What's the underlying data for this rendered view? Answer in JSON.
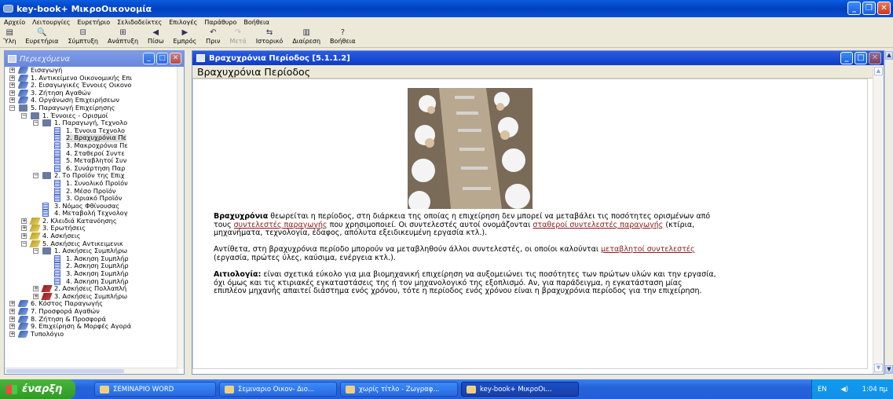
{
  "window": {
    "title": "key-book+   ΜικροΟικονομία"
  },
  "menu": [
    "Αρχείο",
    "Λειτουργίες",
    "Ευρετήριο",
    "Σελιδοδείκτες",
    "Επιλογές",
    "Παράθυρο",
    "Βοήθεια"
  ],
  "toolbar": [
    {
      "label": "Ύλη",
      "icon": "toc-icon",
      "glyph": "▤",
      "enabled": true
    },
    {
      "label": "Ευρετήρια",
      "icon": "search-icon",
      "glyph": "🔍",
      "enabled": true
    },
    {
      "label": "Σύμπτυξη",
      "icon": "collapse-icon",
      "glyph": "⊟",
      "enabled": true
    },
    {
      "label": "Ανάπτυξη",
      "icon": "expand-icon",
      "glyph": "⊞",
      "enabled": true
    },
    {
      "label": "Πίσω",
      "icon": "back-icon",
      "glyph": "◀",
      "enabled": true
    },
    {
      "label": "Εμπρός",
      "icon": "forward-icon",
      "glyph": "▶",
      "enabled": true
    },
    {
      "label": "Πριν",
      "icon": "undo-icon",
      "glyph": "↶",
      "enabled": true
    },
    {
      "label": "Μετά",
      "icon": "redo-icon",
      "glyph": "↷",
      "enabled": false
    },
    {
      "label": "Ιστορικό",
      "icon": "history-icon",
      "glyph": "⇆",
      "enabled": true
    },
    {
      "label": "Διαίρεση",
      "icon": "split-icon",
      "glyph": "▥",
      "enabled": true
    },
    {
      "label": "Βοήθεια",
      "icon": "help-icon",
      "glyph": "?",
      "enabled": true
    }
  ],
  "left_panel": {
    "title": "Περιεχόμενα",
    "tree": [
      {
        "label": "Εισαγωγή",
        "level": 0,
        "icon": "blue",
        "exp": "+"
      },
      {
        "label": "1. Αντικείμενο Οικονομικής Επι",
        "level": 0,
        "icon": "blue",
        "exp": "+"
      },
      {
        "label": "2. Εισαγωγικές Έννοιες Οικονο",
        "level": 0,
        "icon": "blue",
        "exp": "+"
      },
      {
        "label": "3. Ζήτηση Αγαθών",
        "level": 0,
        "icon": "blue",
        "exp": "+"
      },
      {
        "label": "4. Οργάνωση Επιχειρήσεων",
        "level": 0,
        "icon": "blue",
        "exp": "+"
      },
      {
        "label": "5. Παραγωγή Επιχείρησης",
        "level": 0,
        "icon": "book",
        "exp": "−"
      },
      {
        "label": "1. Έννοιες - Ορισμοί",
        "level": 1,
        "icon": "book",
        "exp": "−"
      },
      {
        "label": "1. Παραγωγή, Τεχνολο",
        "level": 2,
        "icon": "book",
        "exp": "−"
      },
      {
        "label": "1. Έννοια Τεχνολο",
        "level": 3,
        "icon": "doc"
      },
      {
        "label": "2. Βραχυχρόνια Πε",
        "level": 3,
        "icon": "doc",
        "selected": true
      },
      {
        "label": "3. Μακροχρόνια Πε",
        "level": 3,
        "icon": "doc"
      },
      {
        "label": "4. Σταθεροί Συντε",
        "level": 3,
        "icon": "doc"
      },
      {
        "label": "5. Μεταβλητοί Συν",
        "level": 3,
        "icon": "doc"
      },
      {
        "label": "6. Συνάρτηση Παρ",
        "level": 3,
        "icon": "doc"
      },
      {
        "label": "2. Το Προϊόν της Επιχ",
        "level": 2,
        "icon": "book",
        "exp": "−"
      },
      {
        "label": "1. Συνολικό Προϊόν",
        "level": 3,
        "icon": "doc"
      },
      {
        "label": "2. Μέσο Προϊόν",
        "level": 3,
        "icon": "doc"
      },
      {
        "label": "3. Οριακό Προϊόν",
        "level": 3,
        "icon": "doc"
      },
      {
        "label": "3. Νόμος Φθίνουσας",
        "level": 2,
        "icon": "doc"
      },
      {
        "label": "4. Μεταβολή Τεχνολογ",
        "level": 2,
        "icon": "doc"
      },
      {
        "label": "2. Κλειδιά Κατανόησης",
        "level": 1,
        "icon": "ylw",
        "exp": "+"
      },
      {
        "label": "3. Ερωτήσεις",
        "level": 1,
        "icon": "ylw",
        "exp": "+"
      },
      {
        "label": "4. Ασκήσεις",
        "level": 1,
        "icon": "ylw",
        "exp": "+"
      },
      {
        "label": "5. Ασκήσεις Αντικειμενικ",
        "level": 1,
        "icon": "ylw",
        "exp": "−"
      },
      {
        "label": "1. Ασκήσεις Συμπλήρω",
        "level": 2,
        "icon": "book",
        "exp": "−"
      },
      {
        "label": "1. Άσκηση Συμπλήρ",
        "level": 3,
        "icon": "doc"
      },
      {
        "label": "2. Άσκηση Συμπλήρ",
        "level": 3,
        "icon": "doc"
      },
      {
        "label": "3. Άσκηση Συμπλήρ",
        "level": 3,
        "icon": "doc"
      },
      {
        "label": "4. Άσκηση Συμπλήρ",
        "level": 3,
        "icon": "doc"
      },
      {
        "label": "2. Ασκήσεις Πολλαπλή",
        "level": 2,
        "icon": "red",
        "exp": "+"
      },
      {
        "label": "3. Ασκήσεις Συμπλήρω",
        "level": 2,
        "icon": "red",
        "exp": "+"
      },
      {
        "label": "6. Κόστος Παραγωγής",
        "level": 0,
        "icon": "blue",
        "exp": "+"
      },
      {
        "label": "7. Προσφορά Αγαθών",
        "level": 0,
        "icon": "blue",
        "exp": "+"
      },
      {
        "label": "8. Ζήτηση & Προσφορά",
        "level": 0,
        "icon": "blue",
        "exp": "+"
      },
      {
        "label": "9. Επιχείρηση & Μορφές Αγορά",
        "level": 0,
        "icon": "blue",
        "exp": "+"
      },
      {
        "label": "Τυπολόγιο",
        "level": 0,
        "icon": "blue",
        "exp": "+"
      }
    ]
  },
  "right_panel": {
    "title": "Βραχυχρόνια Περίοδος   [5.1.1.2]",
    "header": "Βραχυχρόνια Περίοδος",
    "image_alt": "workers-on-assembly-line-photo",
    "p1": {
      "b": "Βραχυχρόνια",
      "t1": " θεωρείται η περίοδος, στη διάρκεια της οποίας η επιχείρηση δεν μπορεί να μεταβάλει τις ποσότητες ορισμένων από τους ",
      "l1": "συντελεστές παραγωγής",
      "t2": " που χρησιμοποιεί. Οι συντελεστές αυτοί ονομάζονται ",
      "l2": "σταθεροί συντελεστές παραγωγής",
      "t3": " (κτίρια, μηχανήματα, τεχνολογία, έδαφος, απόλυτα εξειδικευμένη εργασία κτλ.)."
    },
    "p2": {
      "t1": "Αντίθετα, στη βραχυχρόνια περίοδο μπορούν να μεταβληθούν άλλοι συντελεστές, οι οποίοι καλούνται ",
      "l1": "μεταβλητοί συντελεστές",
      "t2": " (εργασία, πρώτες ύλες, καύσιμα, ενέργεια κτλ.)."
    },
    "p3": {
      "b": "Αιτιολογία:",
      "t1": " είναι σχετικά εύκολο για μια βιομηχανική επιχείρηση να αυξομειώνει τις ποσότητες των πρώτων υλών και την εργασία, όχι όμως και τις κτιριακές εγκαταστάσεις της ή τον μηχανολογικό της εξοπλισμό. Αν, για παράδειγμα, η εγκατάσταση μίας επιπλέον μηχανής απαιτεί διάστημα ενός χρόνου, τότε η περίοδος ενός χρόνου είναι η βραχυχρόνια περίοδος για την επιχείρηση."
    }
  },
  "taskbar": {
    "start": "έναρξη",
    "tasks": [
      {
        "label": "ΣΕΜΙΝΑΡΙΟ WORD",
        "active": false
      },
      {
        "label": "Σεμιναριο Οικον- Διο...",
        "active": false
      },
      {
        "label": "χωρίς τίτλο - Ζωγραφ...",
        "active": false
      },
      {
        "label": "key-book+   ΜικροΟι...",
        "active": true
      }
    ],
    "lang": "EN",
    "clock": "1:04 πμ"
  },
  "colors": {
    "link": "#8a1a1a",
    "title_bar": "#0040c0",
    "panel_title": "#2a5ce0"
  }
}
